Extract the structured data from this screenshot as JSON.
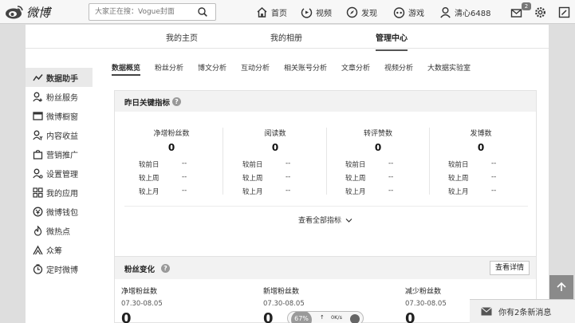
{
  "topbar": {
    "logo_text": "微博",
    "search_placeholder": "大家正在搜：Vogue封面",
    "nav": {
      "home": "首页",
      "video": "视频",
      "discover": "发现",
      "game": "游戏",
      "user": "清心6488"
    },
    "message_badge": "2"
  },
  "subnav": {
    "items": [
      "我的主页",
      "我的相册",
      "管理中心"
    ],
    "active_index": 2
  },
  "sidebar": {
    "items": [
      {
        "label": "数据助手",
        "icon": "trend-icon"
      },
      {
        "label": "粉丝服务",
        "icon": "user-plus-icon"
      },
      {
        "label": "微博橱窗",
        "icon": "window-icon"
      },
      {
        "label": "内容收益",
        "icon": "user-yen-icon"
      },
      {
        "label": "营销推广",
        "icon": "bag-icon"
      },
      {
        "label": "设置管理",
        "icon": "user-gear-icon"
      },
      {
        "label": "我的应用",
        "icon": "grid-icon"
      },
      {
        "label": "微博钱包",
        "icon": "wallet-icon"
      },
      {
        "label": "微热点",
        "icon": "hot-icon"
      },
      {
        "label": "众筹",
        "icon": "crowd-icon"
      },
      {
        "label": "定时微博",
        "icon": "clock-icon"
      }
    ],
    "active_index": 0
  },
  "tabs": {
    "items": [
      "数据概览",
      "粉丝分析",
      "博文分析",
      "互动分析",
      "相关账号分析",
      "文章分析",
      "视频分析",
      "大数据实验室"
    ],
    "active_index": 0
  },
  "yesterday": {
    "title": "昨日关键指标",
    "help": "?",
    "metrics": [
      {
        "name": "净增粉丝数",
        "value": "0"
      },
      {
        "name": "阅读数",
        "value": "0"
      },
      {
        "name": "转评赞数",
        "value": "0"
      },
      {
        "name": "发博数",
        "value": "0"
      }
    ],
    "compare_labels": [
      "较前日",
      "较上周",
      "较上月"
    ],
    "compare_value": "--",
    "see_all": "查看全部指标"
  },
  "fans": {
    "title": "粉丝变化",
    "help": "?",
    "detail_button": "查看详情",
    "columns": [
      {
        "label": "净增粉丝数",
        "date": "07.30-08.05",
        "value": "0"
      },
      {
        "label": "新增粉丝数",
        "date": "07.30-08.05",
        "value": "0"
      },
      {
        "label": "减少粉丝数",
        "date": "07.30-08.05",
        "value": "0"
      }
    ]
  },
  "message_bar": "你有2条新消息",
  "speed_widget": {
    "percent": "67%",
    "rate": "0K/s",
    "up": "↑"
  }
}
